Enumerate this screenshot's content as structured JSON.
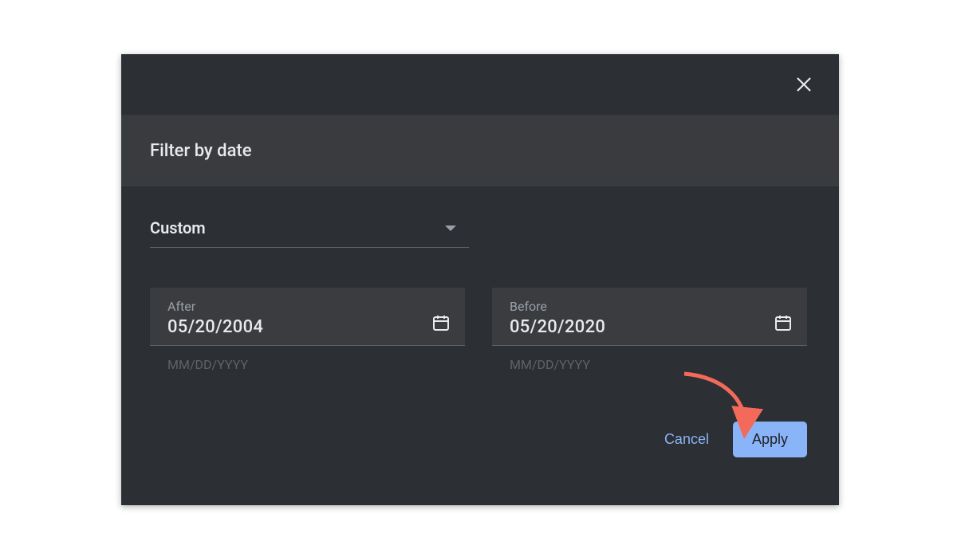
{
  "dialog": {
    "title": "Filter by date",
    "rangeType": "Custom",
    "after": {
      "label": "After",
      "value": "05/20/2004",
      "hint": "MM/DD/YYYY"
    },
    "before": {
      "label": "Before",
      "value": "05/20/2020",
      "hint": "MM/DD/YYYY"
    },
    "cancelLabel": "Cancel",
    "applyLabel": "Apply"
  }
}
